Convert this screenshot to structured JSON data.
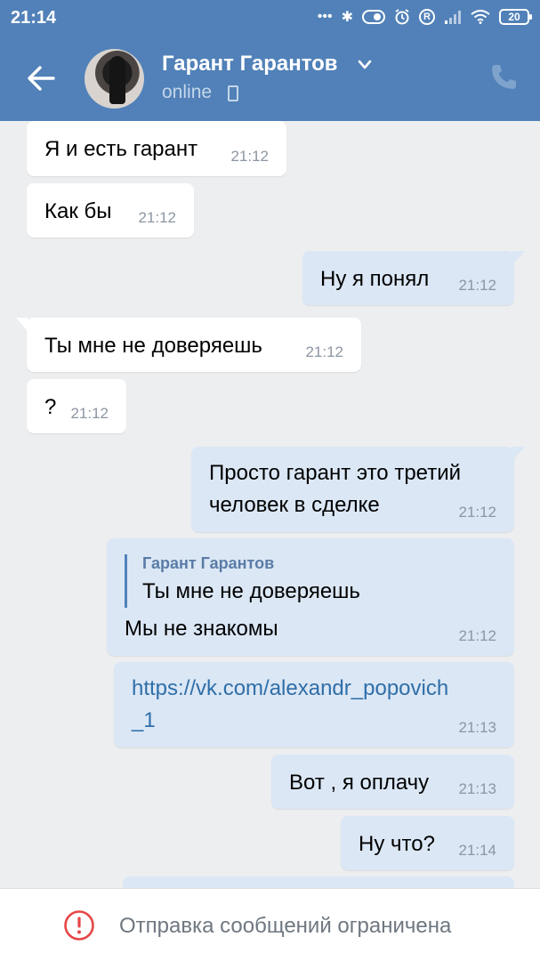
{
  "status_bar": {
    "time": "21:14",
    "dots": "•••",
    "bluetooth": "✱",
    "circle_letter": "R",
    "battery": "20"
  },
  "header": {
    "contact_name": "Гарант Гарантов",
    "contact_status": "online"
  },
  "messages": [
    {
      "direction": "in",
      "text": "Я и есть гарант",
      "time": "21:12"
    },
    {
      "direction": "in",
      "text": "Как бы",
      "time": "21:12"
    },
    {
      "direction": "out",
      "text": "Ну я понял",
      "time": "21:12"
    },
    {
      "direction": "in",
      "text": "Ты мне не доверяешь",
      "time": "21:12"
    },
    {
      "direction": "in",
      "text": "?",
      "time": "21:12"
    },
    {
      "direction": "out",
      "line1": "Просто гарант это третий",
      "line2": "человек в сделке",
      "time": "21:12"
    },
    {
      "direction": "out",
      "quote_author": "Гарант Гарантов",
      "quote_text": "Ты мне не доверяешь",
      "text": "Мы не знакомы",
      "time": "21:12"
    },
    {
      "direction": "out",
      "line1": "https://vk.com/alexandr_popovich",
      "line2": "_1",
      "time": "21:13"
    },
    {
      "direction": "out",
      "text": "Вот , я оплачу",
      "time": "21:13"
    },
    {
      "direction": "out",
      "text": "Ну что?",
      "time": "21:14"
    }
  ],
  "bottom_bar": {
    "restriction_text": "Отправка сообщений ограничена"
  },
  "colors": {
    "brand": "#5181b8",
    "incoming_bubble": "#ffffff",
    "outgoing_bubble": "#dbe7f5",
    "background": "#edeef0",
    "warning": "#e64646"
  }
}
